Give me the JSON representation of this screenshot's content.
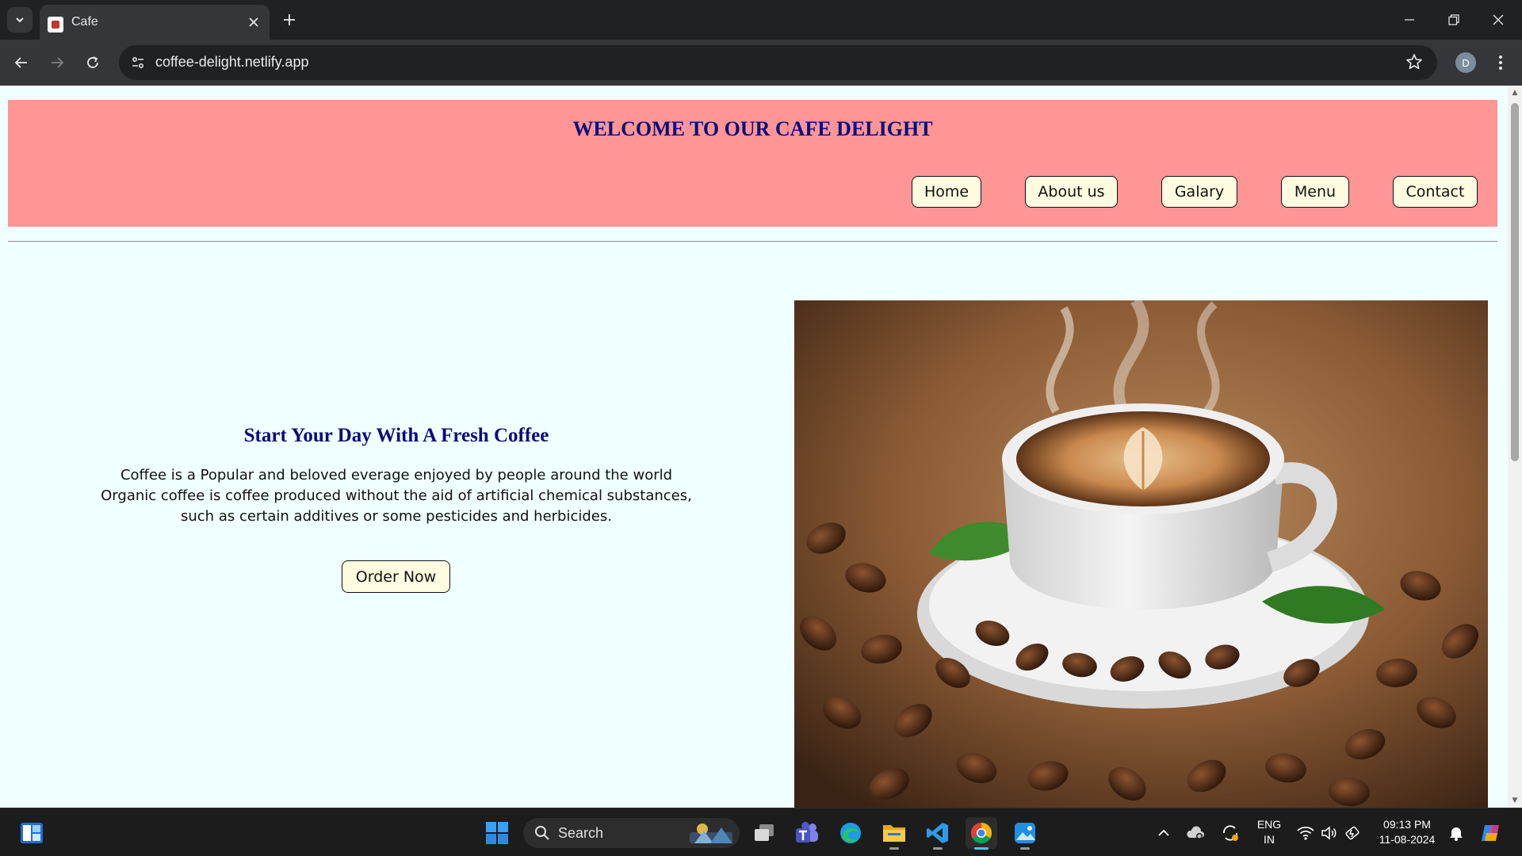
{
  "browser": {
    "tab_title": "Cafe",
    "url": "coffee-delight.netlify.app",
    "profile_initial": "D"
  },
  "page": {
    "site_title": "WELCOME TO OUR CAFE DELIGHT",
    "nav": [
      "Home",
      "About us",
      "Galary",
      "Menu",
      "Contact"
    ],
    "hero": {
      "heading": "Start Your Day With A Fresh Coffee",
      "lines": [
        "Coffee is a Popular and beloved everage enjoyed by people around the world",
        "Organic coffee is coffee produced without the aid of artificial chemical substances,",
        "such as certain additives or some pesticides and herbicides."
      ],
      "button": "Order Now"
    },
    "colors": {
      "header_bg": "#ff9595",
      "page_bg": "#f0ffff",
      "title_color": "#0b0b7a",
      "button_bg": "#fffbe0"
    }
  },
  "taskbar": {
    "search_label": "Search",
    "language_top": "ENG",
    "language_bottom": "IN",
    "time": "09:13 PM",
    "date": "11-08-2024",
    "apps": [
      "widgets-icon",
      "start-icon",
      "task-view-icon",
      "teams-icon",
      "edge-icon",
      "file-explorer-icon",
      "vscode-icon",
      "chrome-icon",
      "photos-icon"
    ]
  }
}
